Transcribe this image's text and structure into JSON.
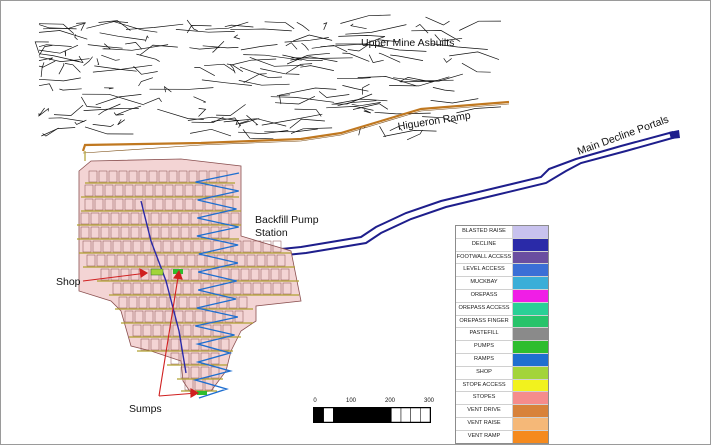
{
  "labels": {
    "upper_mine": "Upper Mine Asbuilts",
    "higueron_ramp": "Higueron Ramp",
    "main_decline": "Main Decline Portals",
    "backfill": "Backfill Pump\nStation",
    "shop": "Shop",
    "sumps": "Sumps"
  },
  "legend": {
    "items": [
      {
        "label": "BLASTED RAISE",
        "color": "#c8c2ee"
      },
      {
        "label": "DECLINE",
        "color": "#2a2aa8"
      },
      {
        "label": "FOOTWALL ACCESS",
        "color": "#6a4ea0"
      },
      {
        "label": "LEVEL ACCESS",
        "color": "#3b6fd6"
      },
      {
        "label": "MUCKBAY",
        "color": "#3aaed8"
      },
      {
        "label": "OREPASS",
        "color": "#f01ee6"
      },
      {
        "label": "OREPASS ACCESS",
        "color": "#2ad096"
      },
      {
        "label": "OREPASS FINGER",
        "color": "#28c36a"
      },
      {
        "label": "PASTEFILL",
        "color": "#8a8a8a"
      },
      {
        "label": "PUMPS",
        "color": "#2ebd2e"
      },
      {
        "label": "RAMPS",
        "color": "#1f6fd0"
      },
      {
        "label": "SHOP",
        "color": "#a3d43a"
      },
      {
        "label": "STOPE ACCESS",
        "color": "#f2f21e"
      },
      {
        "label": "STOPES",
        "color": "#f58c8c"
      },
      {
        "label": "VENT DRIVE",
        "color": "#d8823a"
      },
      {
        "label": "VENT RAISE",
        "color": "#f5b878"
      },
      {
        "label": "VENT RAMP",
        "color": "#f58a1e"
      }
    ]
  },
  "scale": {
    "ticks": [
      "0",
      "100",
      "200",
      "300"
    ]
  },
  "colors": {
    "asbuilt": "#111111",
    "higueron": "#c07820",
    "decline": "#1e1e8c",
    "stope_fill": "#f3d4d4",
    "stope_edge": "#8a5050",
    "drift": "#b0a030",
    "ramp": "#1f6fd0",
    "callout_arrow": "#d02020"
  }
}
